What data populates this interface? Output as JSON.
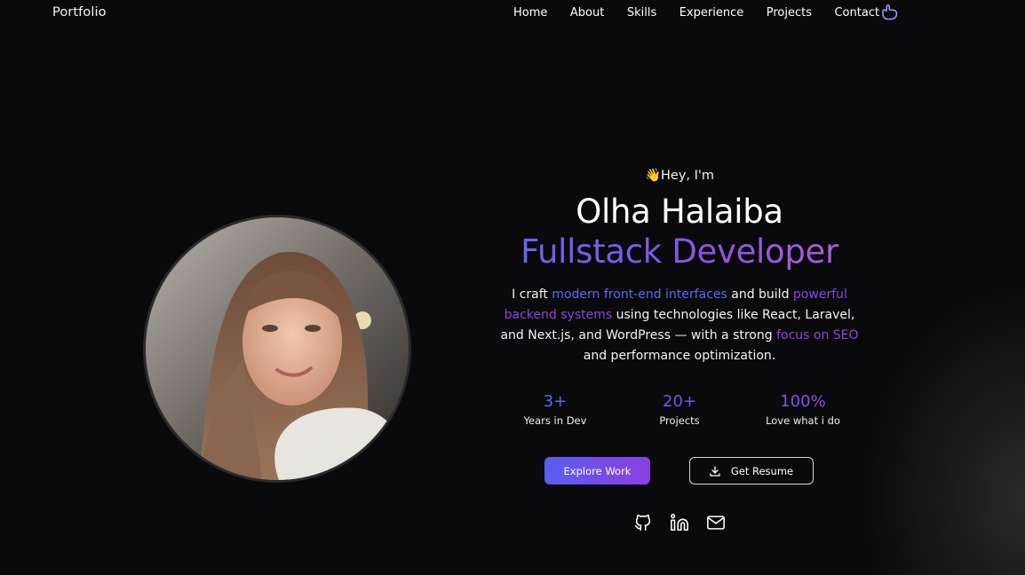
{
  "nav": {
    "brand": "Portfolio",
    "items": [
      {
        "label": "Home"
      },
      {
        "label": "About"
      },
      {
        "label": "Skills"
      },
      {
        "label": "Experience"
      },
      {
        "label": "Projects"
      },
      {
        "label": "Contact"
      }
    ],
    "theme_toggle_icon": "hand-pointing-icon"
  },
  "hero": {
    "greeting_emoji": "👋",
    "greeting": "Hey, I'm",
    "name": "Olha Halaiba",
    "role": "Fullstack Developer",
    "intro": {
      "part1": "I craft ",
      "highlight1": "modern front-end interfaces",
      "part2": " and build ",
      "highlight2": "powerful backend systems",
      "part3": " using technologies like React, Laravel, and Next.js, and WordPress — with a strong ",
      "highlight3": "focus on SEO",
      "part4": " and performance optimization."
    },
    "profile_photo": "portrait-photo"
  },
  "stats": [
    {
      "value": "3+",
      "label": "Years in Dev"
    },
    {
      "value": "20+",
      "label": "Projects"
    },
    {
      "value": "100%",
      "label": "Love what i do"
    }
  ],
  "actions": {
    "primary": "Explore Work",
    "secondary": "Get Resume",
    "secondary_icon": "download-icon"
  },
  "socials": [
    {
      "icon": "github-icon"
    },
    {
      "icon": "linkedin-icon"
    },
    {
      "icon": "mail-icon"
    }
  ],
  "colors": {
    "background": "#0a090b",
    "accent_blue": "#5b6cf1",
    "accent_purple": "#8b47e0",
    "text": "#ffffff"
  }
}
